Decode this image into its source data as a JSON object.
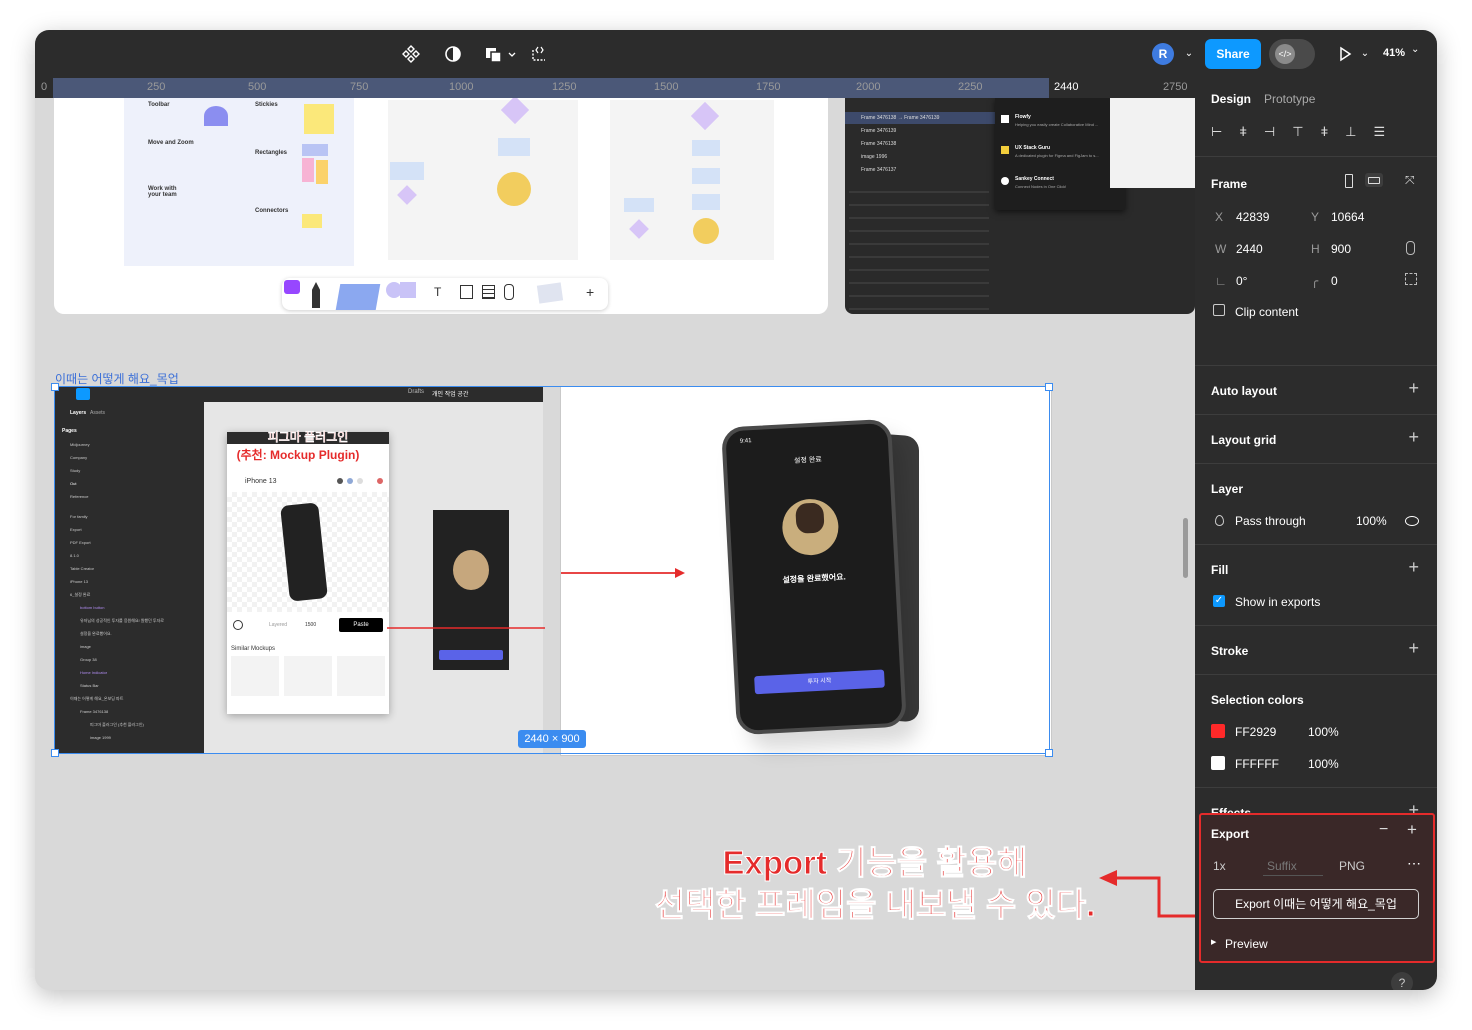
{
  "topbar": {
    "avatar_initial": "R",
    "share_label": "Share",
    "zoom": "41%"
  },
  "ruler": {
    "origin": "0",
    "ticks": [
      "250",
      "500",
      "750",
      "1000",
      "1250",
      "1500",
      "1750",
      "2000",
      "2250",
      "2440",
      "2750"
    ]
  },
  "canvas": {
    "frame_name": "이때는 어떻게 해요_목업",
    "frame_size": "2440 × 900",
    "drafts_label": "Drafts",
    "workspace_label": "개인 작업 공간",
    "plugin_caption_line1": "피그마 플러그인",
    "plugin_caption_line2": "(추천: Mockup Plugin)",
    "plugin_device": "iPhone 13",
    "plugin_paste": "Paste",
    "plugin_similar": "Similar Mockups",
    "plugin_size": "1500",
    "plugin_layered": "Layered",
    "layers_tab": "Layers",
    "assets_tab": "Assets",
    "pages_label": "Pages",
    "pages": [
      "Midjourney",
      "Company",
      "Study",
      "Out",
      "Reference",
      "For family",
      "Export",
      "PDF Export",
      "8.1.0",
      "Table Creator"
    ],
    "layer_items": [
      "iPhone 13",
      "6_설정 완료",
      "bottom button",
      "유저님의 성공적인 투자를 응원해요! 원했던 투자로",
      "설정을 완료했어요.",
      "image",
      "Group 38",
      "Home Indicator",
      "Status Bar",
      "이때는 어떻게 해요_온보딩 파트",
      "Frame 3476138",
      "피그마 플러그인 (추천 플러그인)",
      "image 1999"
    ],
    "phone_time": "9:41",
    "phone_title": "설정 완료",
    "phone_message": "설정을 완료했어요.",
    "phone_cta": "투자 시작",
    "top_frames": [
      "Toolbar",
      "Stickies",
      "Move and Zoom",
      "Rectangles",
      "Work with your team",
      "Connectors"
    ],
    "dark_layers": [
      "Frame 3476138 → Frame 3476139",
      "Frame 3476139",
      "Frame 3476138",
      "image 1996",
      "Frame 3476137"
    ],
    "plugin_list": [
      {
        "name": "Flowfy",
        "desc": "Helping you easily create Collaborative Mind ..."
      },
      {
        "name": "UX Stack Guru",
        "desc": "A dedicated plugin for Figma and FigJam to s..."
      },
      {
        "name": "Sankey Connect",
        "desc": "Connect Nodes in One Click!"
      }
    ]
  },
  "panel": {
    "tab_design": "Design",
    "tab_prototype": "Prototype",
    "frame_label": "Frame",
    "x_label": "X",
    "x_value": "42839",
    "y_label": "Y",
    "y_value": "10664",
    "w_label": "W",
    "w_value": "2440",
    "h_label": "H",
    "h_value": "900",
    "rotation": "0°",
    "radius": "0",
    "clip_content": "Clip content",
    "auto_layout": "Auto layout",
    "layout_grid": "Layout grid",
    "layer": "Layer",
    "blend_mode": "Pass through",
    "layer_opacity": "100%",
    "fill": "Fill",
    "show_in_exports": "Show in exports",
    "stroke": "Stroke",
    "selection_colors": "Selection colors",
    "colors": [
      {
        "hex": "FF2929",
        "opacity": "100%",
        "swatch": "#ff2929"
      },
      {
        "hex": "FFFFFF",
        "opacity": "100%",
        "swatch": "#ffffff"
      }
    ],
    "effects": "Effects",
    "export": "Export",
    "export_scale": "1x",
    "export_suffix": "Suffix",
    "export_format": "PNG",
    "export_button": "Export 이때는 어떻게 해요_목업",
    "preview": "Preview"
  },
  "annotation": {
    "line1": "Export 기능을 활용해",
    "line2": "선택한 프레임을 내보낼 수 있다."
  },
  "colors": {
    "accent": "#0d99ff",
    "annotation_red": "#e52b2b",
    "panel_bg": "#2c2c2c",
    "canvas_bg": "#d9d9d9",
    "selection": "#3b8cf0"
  }
}
